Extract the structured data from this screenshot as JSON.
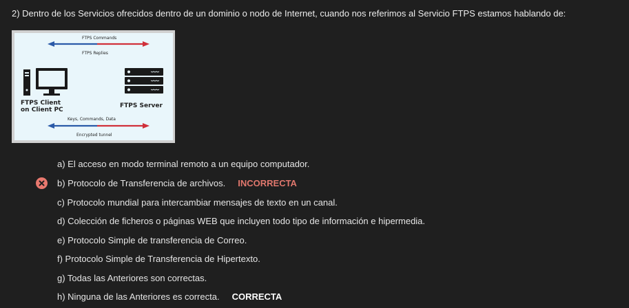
{
  "question": {
    "text": "2) Dentro de los Servicios ofrecidos dentro de un dominio o nodo de Internet, cuando nos referimos al Servicio FTPS estamos hablando de:"
  },
  "figure": {
    "label_commands": "FTPS Commands",
    "label_replies": "FTPS Replies",
    "client_label_1": "FTPS Client",
    "client_label_2": "on Client PC",
    "server_label": "FTPS Server",
    "label_keys": "Keys, Commands, Data",
    "label_tunnel": "Encrypted tunnel",
    "colors": {
      "arrow_blue": "#2a5aa8",
      "arrow_red": "#d0303a",
      "device": "#1a1a1a"
    },
    "icons": [
      "desktop-computer-icon",
      "server-rack-icon"
    ]
  },
  "options": [
    {
      "text": "a) El acceso en modo terminal remoto a un equipo computador.",
      "verdict": ""
    },
    {
      "text": "b) Protocolo de Transferencia de archivos.",
      "verdict": "INCORRECTA"
    },
    {
      "text": "c) Protocolo mundial para intercambiar mensajes de texto en un canal.",
      "verdict": ""
    },
    {
      "text": "d) Colección de ficheros o páginas WEB que incluyen todo tipo de información e hipermedia.",
      "verdict": ""
    },
    {
      "text": "e) Protocolo Simple de transferencia de Correo.",
      "verdict": ""
    },
    {
      "text": "f) Protocolo Simple de Transferencia de Hipertexto.",
      "verdict": ""
    },
    {
      "text": "g) Todas las Anteriores son correctas.",
      "verdict": ""
    },
    {
      "text": "h) Ninguna de las Anteriores es correcta.",
      "verdict": "CORRECTA"
    }
  ],
  "colors": {
    "background": "#1f1f1f",
    "incorrect": "#e0776d",
    "correct": "#ffffff"
  }
}
